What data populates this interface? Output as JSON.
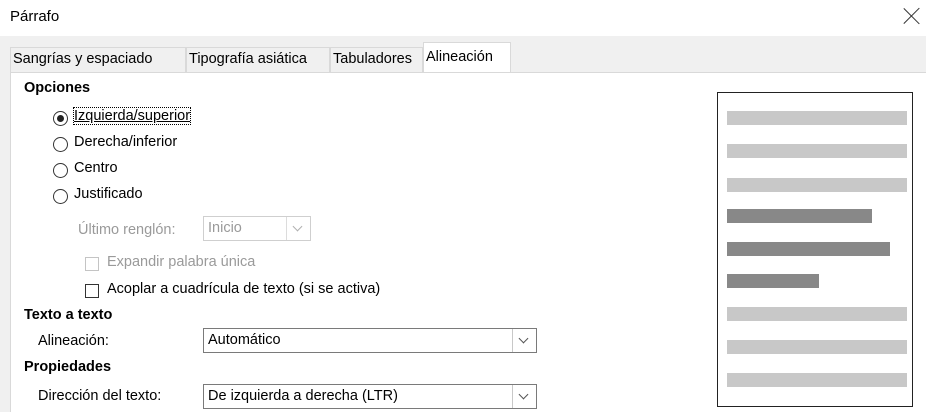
{
  "window": {
    "title": "Párrafo"
  },
  "tabs": [
    {
      "label": "Sangrías y espaciado",
      "active": false
    },
    {
      "label": "Tipografía asiática",
      "active": false
    },
    {
      "label": "Tabuladores",
      "active": false
    },
    {
      "label": "Alineación",
      "active": true
    }
  ],
  "options": {
    "heading": "Opciones",
    "radios": [
      {
        "label": "Izquierda/superior",
        "checked": true
      },
      {
        "label": "Derecha/inferior",
        "checked": false
      },
      {
        "label": "Centro",
        "checked": false
      },
      {
        "label": "Justificado",
        "checked": false
      }
    ],
    "last_line": {
      "label": "Último renglón:",
      "value": "Inicio",
      "enabled": false
    },
    "expand_word": {
      "label": "Expandir palabra única",
      "checked": false,
      "enabled": false
    },
    "snap_grid": {
      "label": "Acoplar a cuadrícula de texto (si se activa)",
      "checked": false
    }
  },
  "text_to_text": {
    "heading": "Texto a texto",
    "alignment_label": "Alineación:",
    "alignment_value": "Automático"
  },
  "properties": {
    "heading": "Propiedades",
    "direction_label": "Dirección del texto:",
    "direction_value": "De izquierda a derecha (LTR)"
  },
  "colors": {
    "preview_light": "#c8c8c8",
    "preview_dark": "#888888"
  }
}
